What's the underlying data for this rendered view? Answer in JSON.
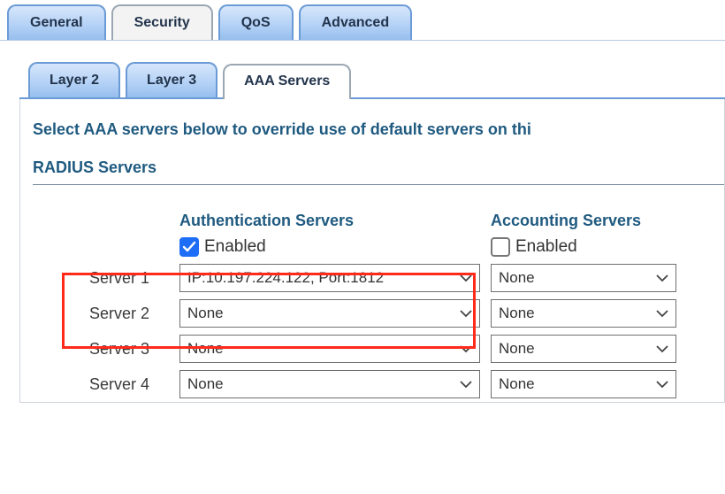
{
  "top_tabs": {
    "general": "General",
    "security": "Security",
    "qos": "QoS",
    "advanced": "Advanced",
    "active": "security"
  },
  "sub_tabs": {
    "layer2": "Layer 2",
    "layer3": "Layer 3",
    "aaa": "AAA Servers",
    "active": "aaa"
  },
  "instruction": "Select AAA servers below to override use of default servers on thi",
  "section_title": "RADIUS Servers",
  "columns": {
    "auth": "Authentication Servers",
    "acct": "Accounting Servers"
  },
  "enabled_label": "Enabled",
  "auth_enabled": true,
  "acct_enabled": false,
  "rows": [
    {
      "label": "Server 1",
      "auth": "IP:10.197.224.122, Port:1812",
      "acct": "None"
    },
    {
      "label": "Server 2",
      "auth": "None",
      "acct": "None"
    },
    {
      "label": "Server 3",
      "auth": "None",
      "acct": "None"
    },
    {
      "label": "Server 4",
      "auth": "None",
      "acct": "None"
    }
  ],
  "colors": {
    "highlight": "#ff2a1a",
    "accent": "#1f5a80",
    "tab_blue": "#a9c9f1"
  }
}
